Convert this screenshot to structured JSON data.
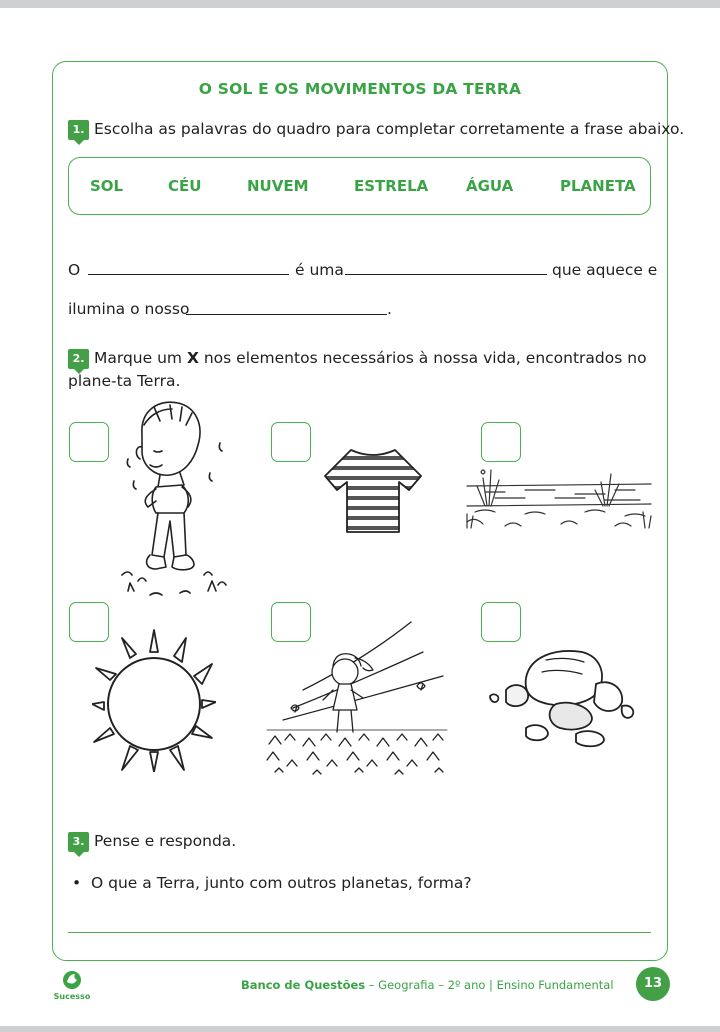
{
  "title": "O SOL E OS MOVIMENTOS DA TERRA",
  "q1": {
    "number": "1.",
    "text": "Escolha as palavras do quadro para completar corretamente a frase abaixo.",
    "words": [
      "SOL",
      "CÉU",
      "NUVEM",
      "ESTRELA",
      "ÁGUA",
      "PLANETA"
    ],
    "sentence_start": "O",
    "sentence_mid": "é uma",
    "sentence_end": "que aquece e",
    "sentence_line2": "ilumina o nosso",
    "sentence_period": "."
  },
  "q2": {
    "number": "2.",
    "text_before": "Marque um",
    "mark": "X",
    "text_after": "nos elementos necessários à nossa vida, encontrados no plane-ta Terra."
  },
  "images": [
    "boy-sweating-illustration",
    "striped-shirt-illustration",
    "river-illustration",
    "sun-illustration",
    "girl-in-wind-illustration",
    "rocks-illustration"
  ],
  "q3": {
    "number": "3.",
    "text": "Pense e responda.",
    "bullet": "•",
    "question": "O que a Terra, junto com outros planetas, forma?"
  },
  "footer": {
    "bold": "Banco de Questões",
    "rest": " – Geografia – 2º ano | Ensino Fundamental",
    "page": "13",
    "logo_text": "Sucesso"
  },
  "colors": {
    "accent": "#3aa345",
    "border": "#4caf50"
  }
}
